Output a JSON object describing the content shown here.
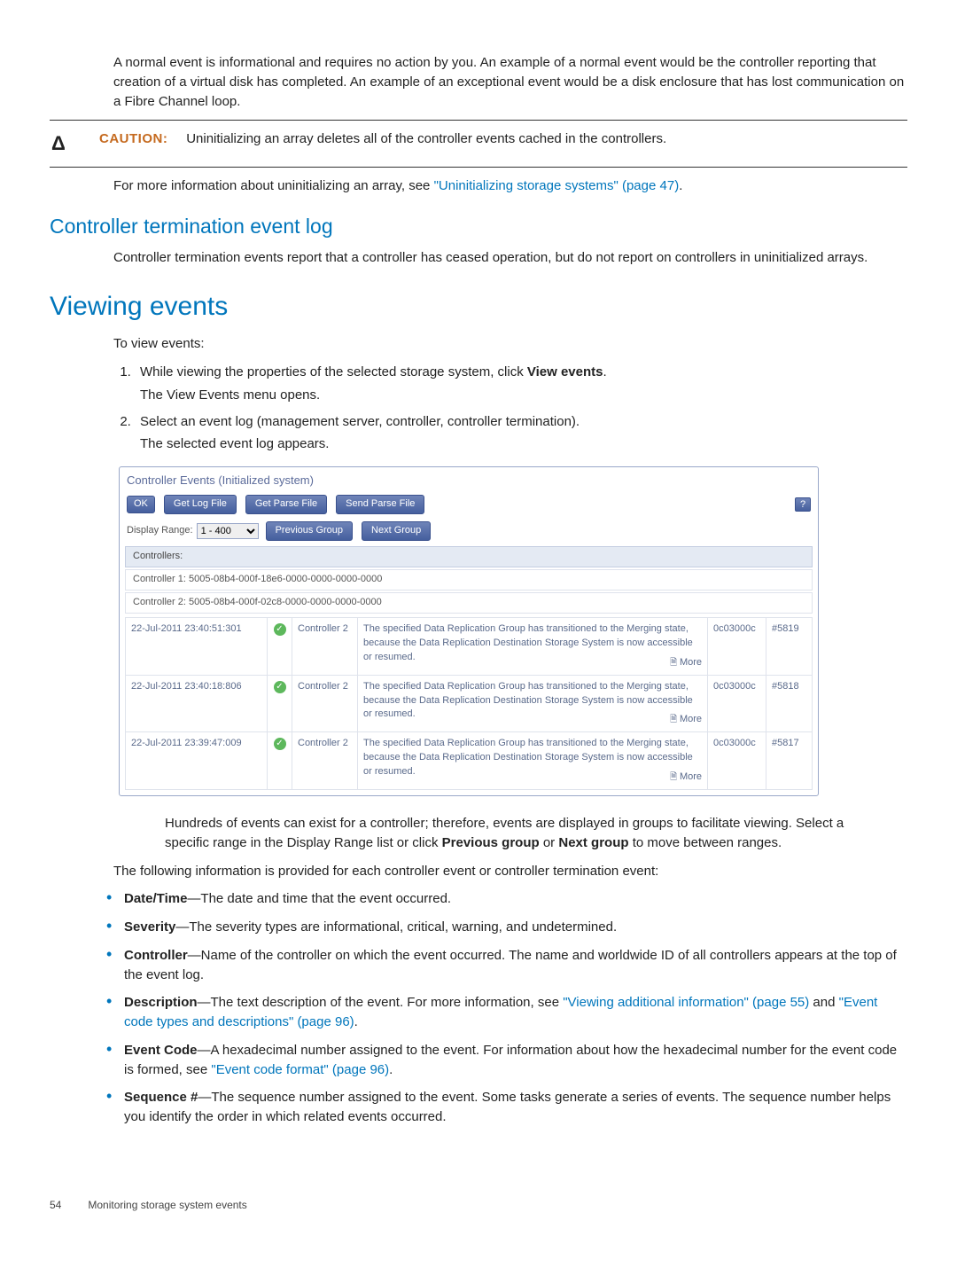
{
  "intro_para": "A normal event is informational and requires no action by you. An example of a normal event would be the controller reporting that creation of a virtual disk has completed. An example of an exceptional event would be a disk enclosure that has lost communication on a Fibre Channel loop.",
  "caution": {
    "symbol": "Δ",
    "label": "CAUTION:",
    "text": "Uninitializing an array deletes all of the controller events cached in the controllers."
  },
  "after_caution": {
    "pre": "For more information about uninitializing an array, see ",
    "link": "\"Uninitializing storage systems\" (page 47)",
    "post": "."
  },
  "sec_term_title": "Controller termination event log",
  "sec_term_body": "Controller termination events report that a controller has ceased operation, but do not report on controllers in uninitialized arrays.",
  "view_events_title": "Viewing events",
  "view_events_intro": "To view events:",
  "steps": [
    {
      "text_pre": "While viewing the properties of the selected storage system, click ",
      "text_bold": "View events",
      "text_post": ".",
      "sub": "The View Events menu opens."
    },
    {
      "text_pre": "Select an event log (management server, controller, controller termination).",
      "text_bold": "",
      "text_post": "",
      "sub": "The selected event log appears."
    }
  ],
  "shot": {
    "title": "Controller Events  (Initialized system)",
    "buttons": {
      "ok": "OK",
      "getlog": "Get Log File",
      "getparse": "Get Parse File",
      "sendparse": "Send Parse File"
    },
    "range_label": "Display Range:",
    "range_sel": "1 - 400",
    "prev": "Previous Group",
    "next": "Next Group",
    "controllers_hdr": "Controllers:",
    "ctrl1": "Controller 1: 5005-08b4-000f-18e6-0000-0000-0000-0000",
    "ctrl2": "Controller 2: 5005-08b4-000f-02c8-0000-0000-0000-0000",
    "rows": [
      {
        "dt": "22-Jul-2011 23:40:51:301",
        "ctrl": "Controller 2",
        "desc": "The specified Data Replication Group has transitioned to the Merging state, because the Data Replication Destination Storage System is now accessible or resumed.",
        "code": "0c03000c",
        "seq": "#5819",
        "more": "More"
      },
      {
        "dt": "22-Jul-2011 23:40:18:806",
        "ctrl": "Controller 2",
        "desc": "The specified Data Replication Group has transitioned to the Merging state, because the Data Replication Destination Storage System is now accessible or resumed.",
        "code": "0c03000c",
        "seq": "#5818",
        "more": "More"
      },
      {
        "dt": "22-Jul-2011 23:39:47:009",
        "ctrl": "Controller 2",
        "desc": "The specified Data Replication Group has transitioned to the Merging state, because the Data Replication Destination Storage System is now accessible or resumed.",
        "code": "0c03000c",
        "seq": "#5817",
        "more": "More"
      }
    ]
  },
  "after_shot": {
    "p1_a": "Hundreds of events can exist for a controller; therefore, events are displayed in groups to facilitate viewing. Select a specific range in the Display Range list or click ",
    "p1_b": "Previous group",
    "p1_c": " or ",
    "p1_d": "Next group",
    "p1_e": " to move between ranges."
  },
  "list_intro": "The following information is provided for each controller event or controller termination event:",
  "bullets": {
    "b1": {
      "h": "Date/Time",
      "t": "—The date and time that the event occurred."
    },
    "b2": {
      "h": "Severity",
      "t": "—The severity types are informational, critical, warning, and undetermined."
    },
    "b3": {
      "h": "Controller",
      "t": "—Name of the controller on which the event occurred. The name and worldwide ID of all controllers appears at the top of the event log."
    },
    "b4": {
      "h": "Description",
      "t1": "—The text description of the event. For more information, see ",
      "l1": "\"Viewing additional information\" (page 55)",
      "t2": " and ",
      "l2": "\"Event code types and descriptions\" (page 96)",
      "t3": "."
    },
    "b5": {
      "h": "Event Code",
      "t1": "—A hexadecimal number assigned to the event. For information about how the hexadecimal number for the event code is formed, see ",
      "l1": "\"Event code format\" (page 96)",
      "t2": "."
    },
    "b6": {
      "h": "Sequence #",
      "t": "—The sequence number assigned to the event. Some tasks generate a series of events. The sequence number helps you identify the order in which related events occurred."
    }
  },
  "footer": {
    "page": "54",
    "chapter": "Monitoring storage system events"
  }
}
